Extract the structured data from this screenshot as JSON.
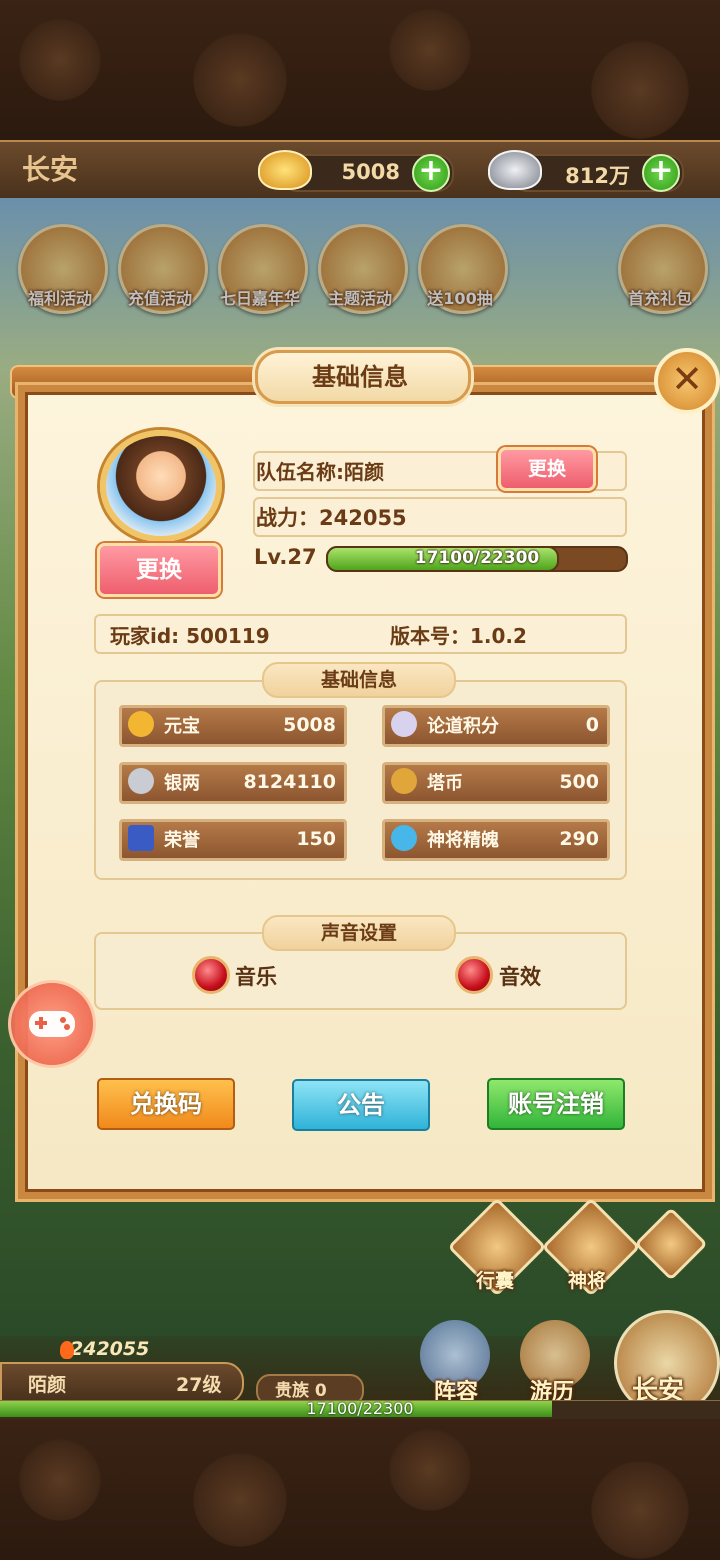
{
  "top_bar": {
    "city": "长安",
    "gold_value": "5008",
    "silver_value": "812万"
  },
  "activities": [
    {
      "label": "福利活动"
    },
    {
      "label": "充值活动"
    },
    {
      "label": "七日嘉年华"
    },
    {
      "label": "主题活动"
    },
    {
      "label": "送100抽"
    },
    {
      "label": "首充礼包"
    }
  ],
  "modal": {
    "title": "基础信息",
    "change_avatar_label": "更换",
    "team_name": "队伍名称:陌颜",
    "change_name_label": "更换",
    "power": "战力：242055",
    "level": "Lv.27",
    "xp_text": "17100/22300",
    "xp_fraction": 0.767,
    "player_id": "玩家id: 500119",
    "version": "版本号：1.0.2",
    "basic_section_title": "基础信息",
    "currencies": [
      {
        "name": "元宝",
        "value": "5008",
        "icon": "gold-ingot-icon",
        "color": "#f2b632"
      },
      {
        "name": "论道积分",
        "value": "0",
        "icon": "scroll-icon",
        "color": "#d9d2ef"
      },
      {
        "name": "银两",
        "value": "8124110",
        "icon": "silver-ingot-icon",
        "color": "#c9ccd2"
      },
      {
        "name": "塔币",
        "value": "500",
        "icon": "tower-coin-icon",
        "color": "#e0a63a"
      },
      {
        "name": "荣誉",
        "value": "150",
        "icon": "honor-badge-icon",
        "color": "#3b5bc4"
      },
      {
        "name": "神将精魄",
        "value": "290",
        "icon": "soul-crystal-icon",
        "color": "#47b6e8"
      }
    ],
    "sound_section_title": "声音设置",
    "music_label": "音乐",
    "sfx_label": "音效",
    "redeem_label": "兑换码",
    "notice_label": "公告",
    "logout_label": "账号注销"
  },
  "hud": {
    "power": "242055",
    "player_name": "陌颜",
    "player_level": "27级",
    "noble": "贵族 0",
    "xp_text": "17100/22300",
    "xp_fraction": 0.767,
    "nav_bag": "行囊",
    "nav_generals": "神将",
    "nav_lineup": "阵容",
    "nav_travel": "游历",
    "nav_city": "长安"
  }
}
